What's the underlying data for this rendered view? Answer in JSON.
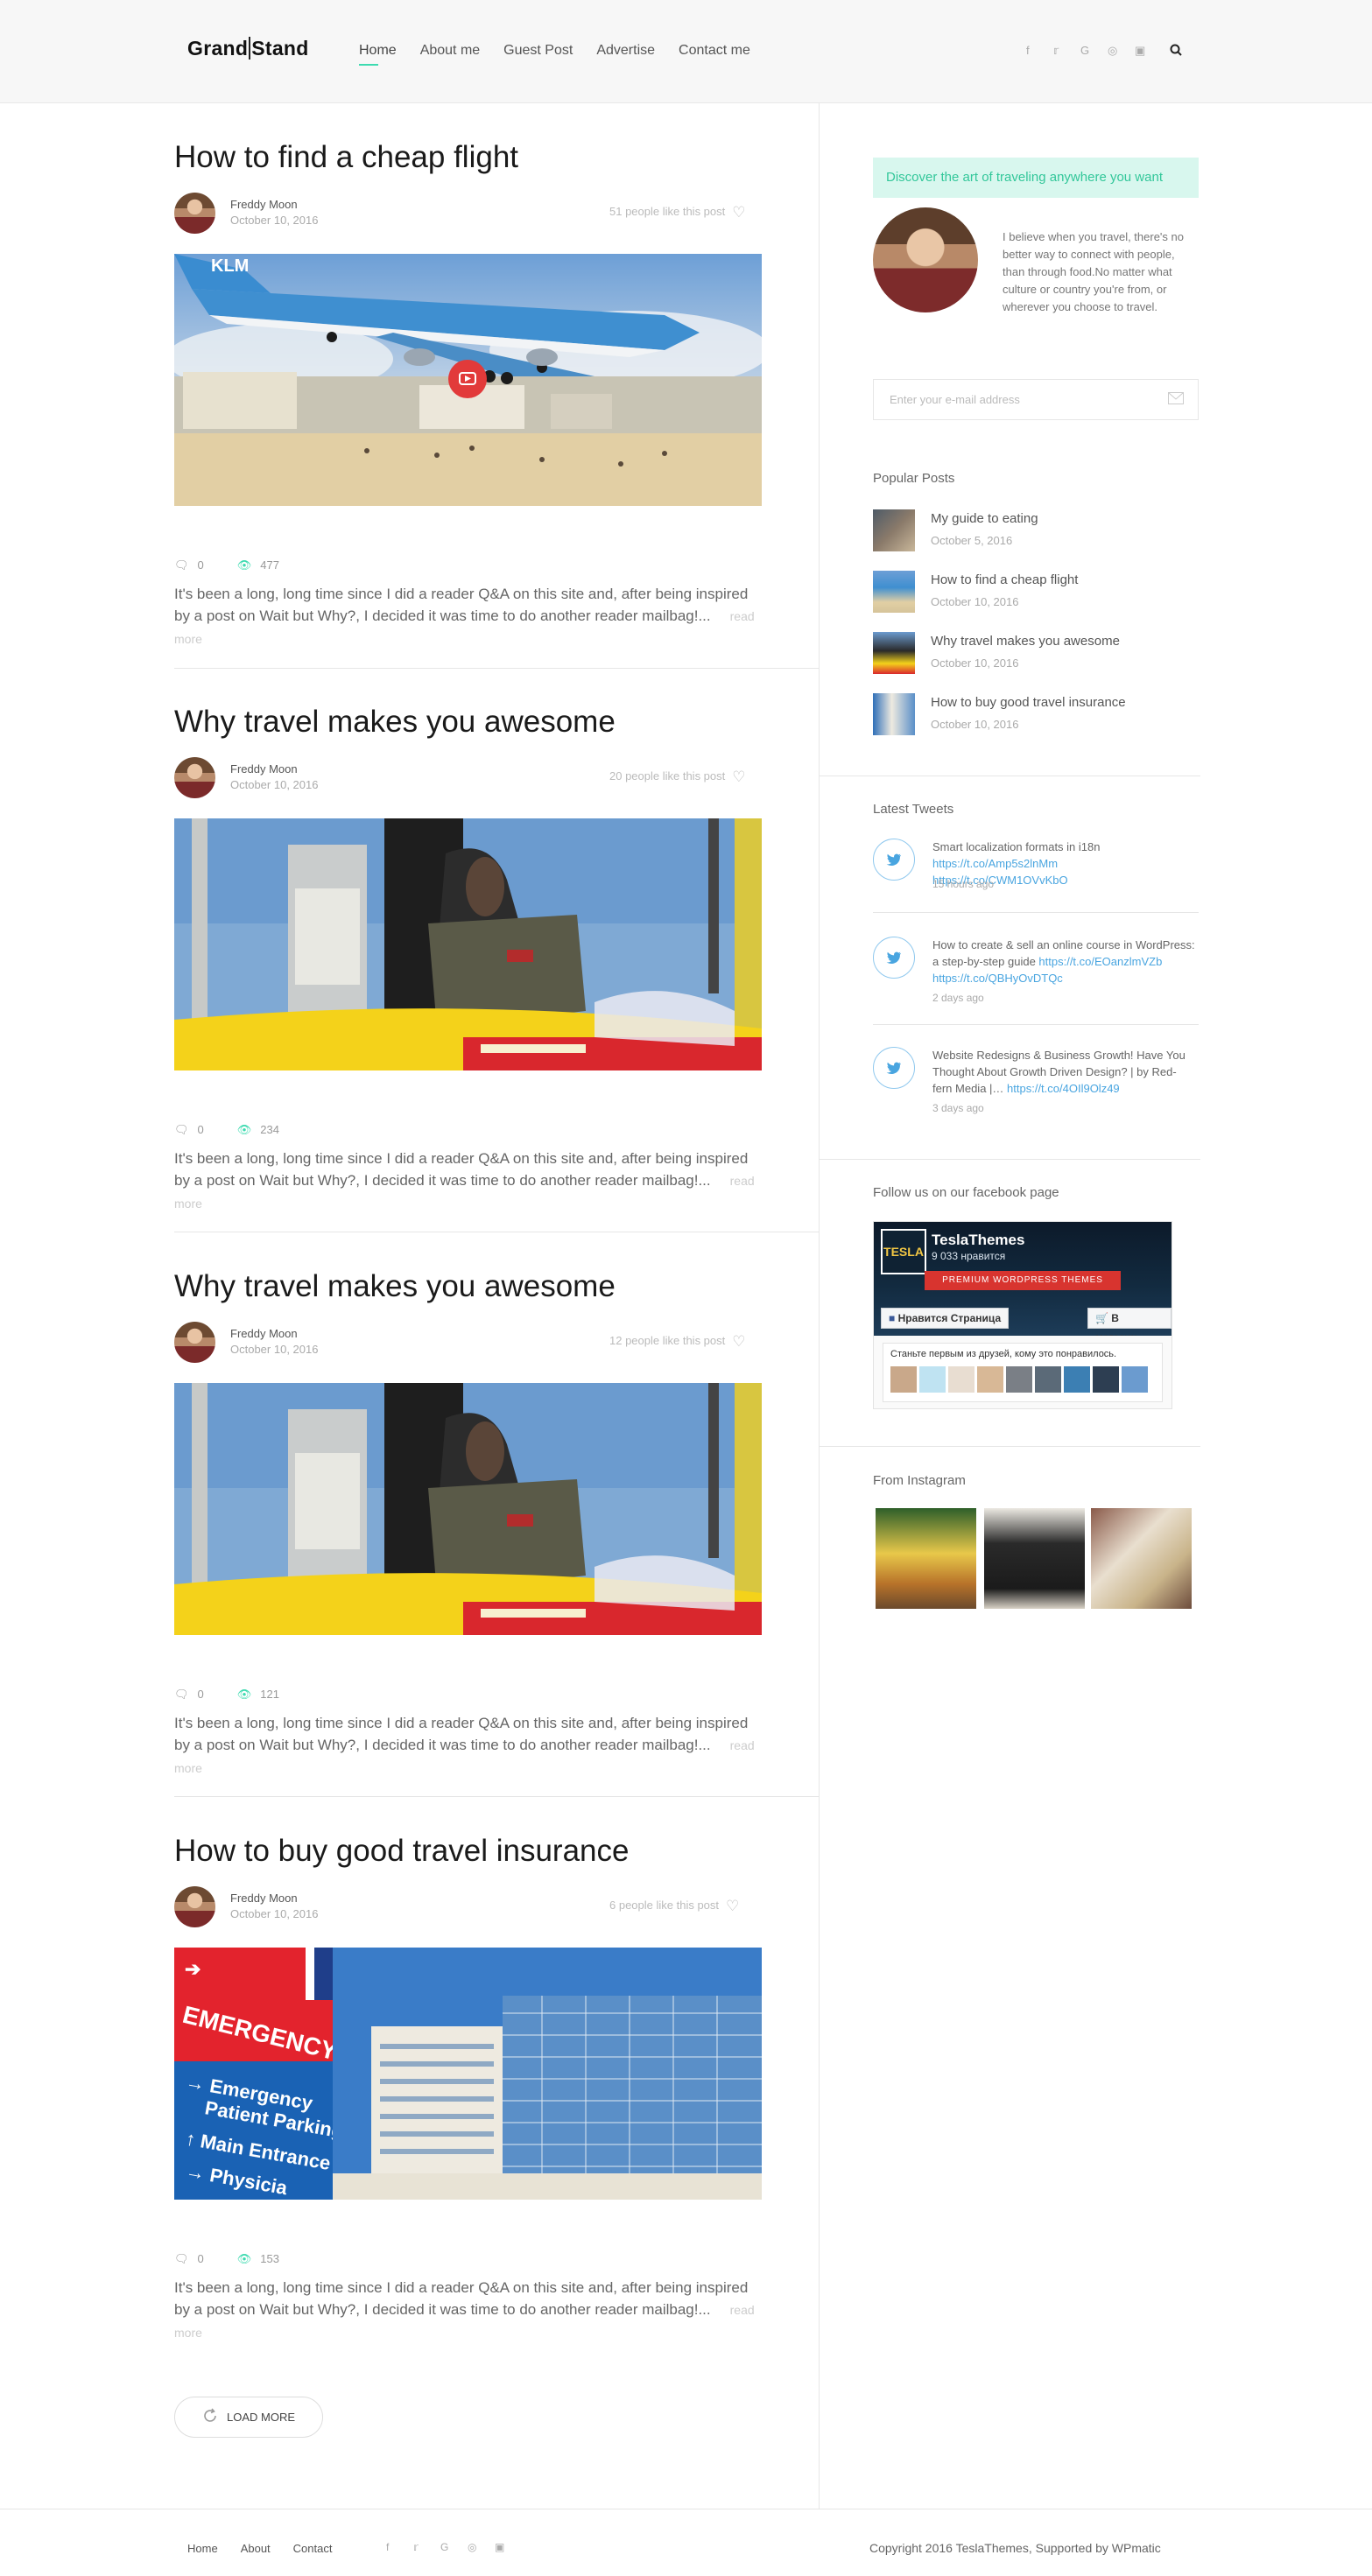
{
  "site": {
    "logo_left": "Grand",
    "logo_right": "Stand"
  },
  "nav": [
    "Home",
    "About me",
    "Guest Post",
    "Advertise",
    "Contact me"
  ],
  "social_icons": [
    "facebook-icon",
    "twitter-icon",
    "google-plus-icon",
    "pinterest-icon",
    "instagram-icon"
  ],
  "posts": [
    {
      "title": "How to find a cheap flight",
      "author": "Freddy Moon",
      "date": "October 10, 2016",
      "likes": "51 people like this post",
      "comments": "0",
      "views": "477",
      "excerpt": "It's been a long, long time since I did a reader Q&A on this site and, after being inspired by a post on Wait but Why?, I decided it was time to do another reader mailbag!...",
      "read_more": "read more",
      "image": "plane"
    },
    {
      "title": "Why travel makes you awesome",
      "author": "Freddy Moon",
      "date": "October 10, 2016",
      "likes": "20 people like this post",
      "comments": "0",
      "views": "234",
      "excerpt": "It's been a long, long time since I did a reader Q&A on this site and, after being inspired by a post on Wait but Why?, I decided it was time to do another reader mailbag!...",
      "read_more": "read more",
      "image": "balloon"
    },
    {
      "title": "Why travel makes you awesome",
      "author": "Freddy Moon",
      "date": "October 10, 2016",
      "likes": "12 people like this post",
      "comments": "0",
      "views": "121",
      "excerpt": "It's been a long, long time since I did a reader Q&A on this site and, after being inspired by a post on Wait but Why?, I decided it was time to do another reader mailbag!...",
      "read_more": "read more",
      "image": "balloon"
    },
    {
      "title": "How to buy good travel insurance",
      "author": "Freddy Moon",
      "date": "October 10, 2016",
      "likes": "6 people like this post",
      "comments": "0",
      "views": "153",
      "excerpt": "It's been a long, long time since I did a reader Q&A on this site and, after being inspired by a post on Wait but Why?, I decided it was time to do another reader mailbag!...",
      "read_more": "read more",
      "image": "hospital"
    }
  ],
  "load_more": "LOAD MORE",
  "sidebar": {
    "promo": "Discover the art of traveling anywhere you want",
    "bio": "I believe when you travel, there's no better way to connect with people, than through food.No matter what culture or country you're from, or wherever you choose to travel.",
    "email_placeholder": "Enter your e-mail address",
    "popular_heading": "Popular Posts",
    "popular": [
      {
        "title": "My guide to eating",
        "date": "October 5, 2016"
      },
      {
        "title": "How to find a cheap flight",
        "date": "October 10, 2016"
      },
      {
        "title": "Why travel makes you awesome",
        "date": "October 10, 2016"
      },
      {
        "title": "How to buy good travel insurance",
        "date": "October 10, 2016"
      }
    ],
    "tweets_heading": "Latest Tweets",
    "tweets": [
      {
        "text": "Smart localization formats in i18n ",
        "link": "https://t.co/Amp5s2lnMm https://t.co/CWM1OVvKbO",
        "date": "15 hours ago"
      },
      {
        "text": "How to create & sell an online course in WordPress: a step-by-step guide ",
        "link": "https://t.co/EOanzlmVZb https://t.co/QBHyOvDTQc",
        "date": "2 days ago"
      },
      {
        "text": "Website Redesigns & Business Growth! Have You Thought About Growth Driven Design? | by Red-fern Media |… ",
        "link": "https://t.co/4OIl9Olz49",
        "date": "3 days ago"
      }
    ],
    "facebook_heading": "Follow us on our facebook page",
    "facebook": {
      "logo": "TESLA",
      "name": "TeslaThemes",
      "likes": "9 033 нравится",
      "ribbon": "PREMIUM WORDPRESS THEMES",
      "like_btn": "Нравится Страница",
      "shop_btn": "В магазин",
      "friends_text": "Станьте первым из друзей, кому это понравилось."
    },
    "instagram_heading": "From Instagram"
  },
  "footer": {
    "nav": [
      "Home",
      "About",
      "Contact"
    ],
    "copyright": "Copyright 2016 TeslaThemes, Supported by WPmatic"
  },
  "colors": {
    "accent": "#3ddbb0",
    "twitter": "#49a5e0",
    "promo_bg": "#d8f7ee"
  }
}
